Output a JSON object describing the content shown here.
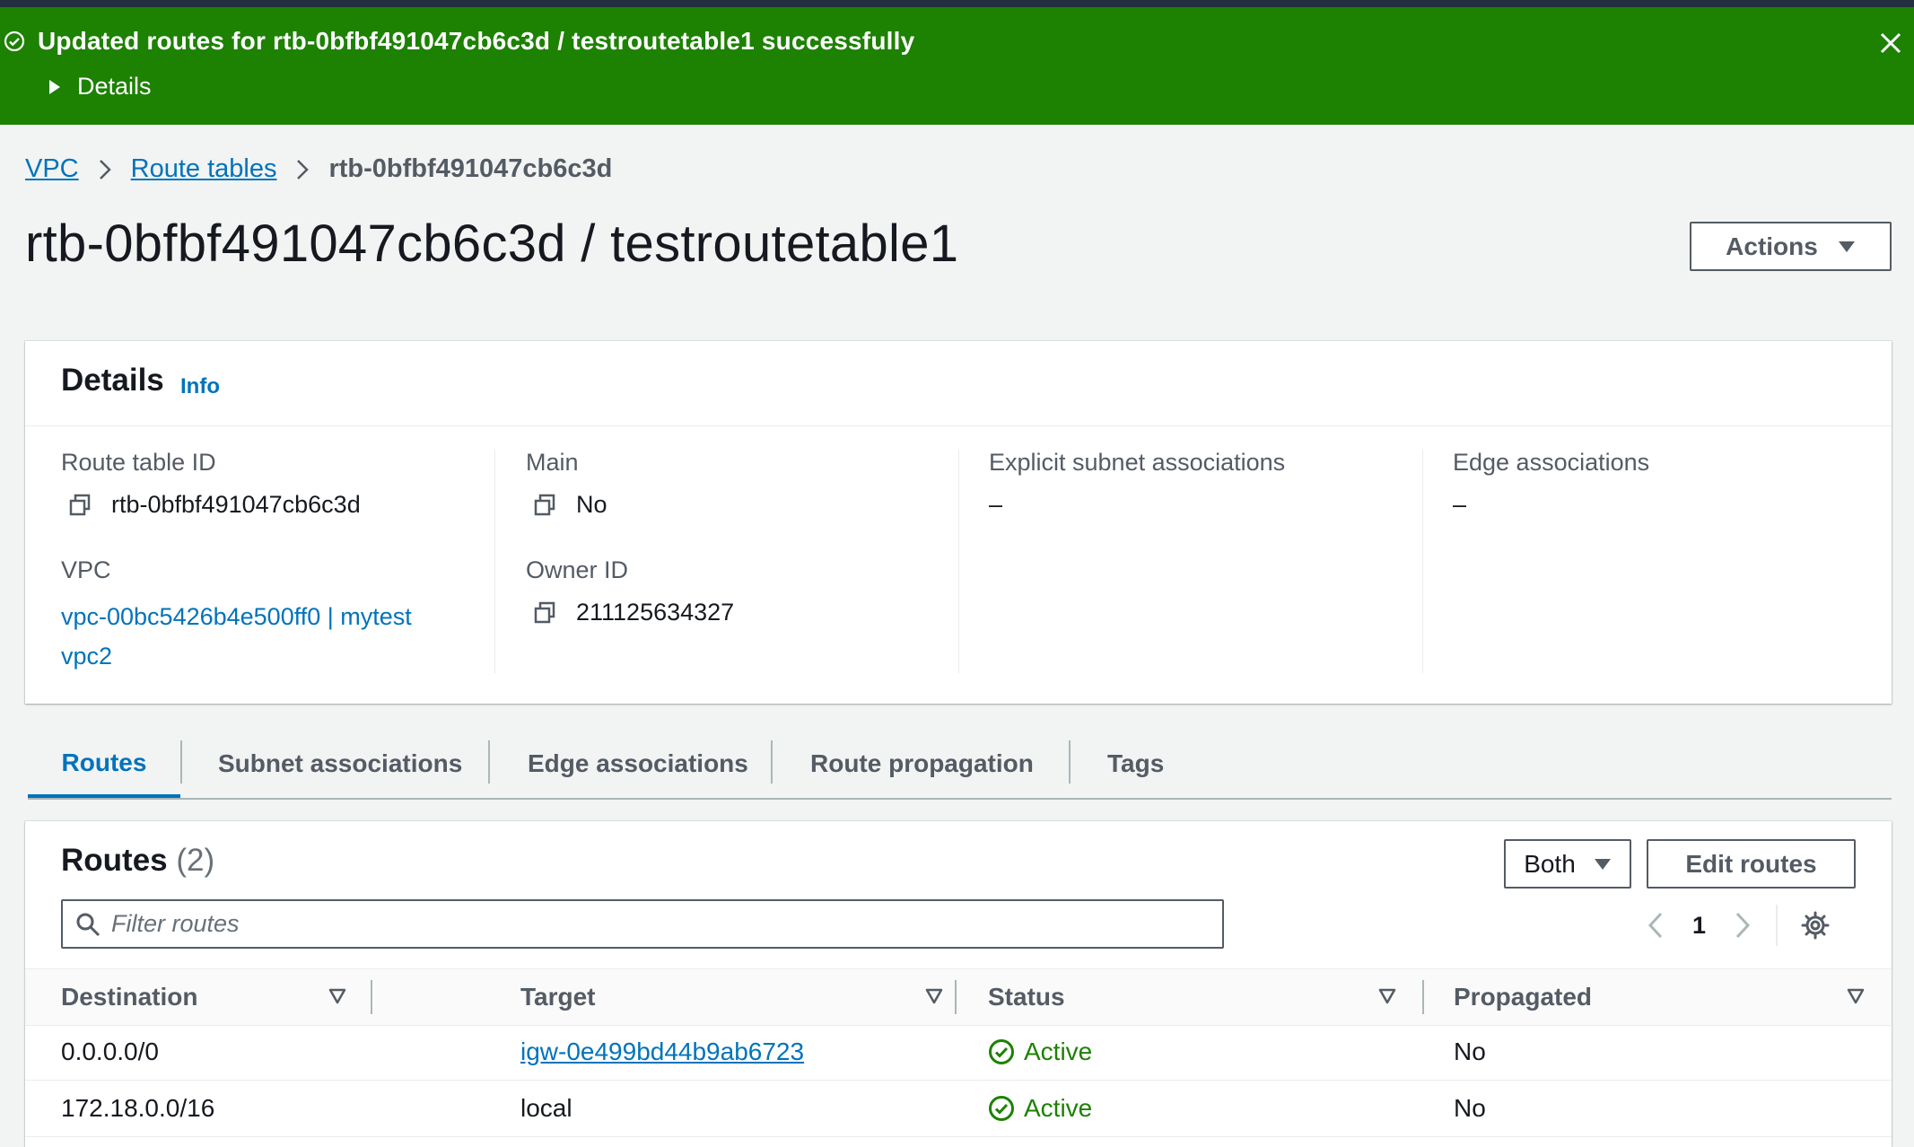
{
  "flash": {
    "message": "Updated routes for rtb-0bfbf491047cb6c3d / testroutetable1 successfully",
    "details_label": "Details",
    "type": "success",
    "color": "#1d8102"
  },
  "breadcrumb": {
    "items": [
      "VPC",
      "Route tables"
    ],
    "current": "rtb-0bfbf491047cb6c3d"
  },
  "page": {
    "title": "rtb-0bfbf491047cb6c3d / testroutetable1",
    "actions_label": "Actions"
  },
  "details": {
    "heading": "Details",
    "info_label": "Info",
    "route_table_id_label": "Route table ID",
    "route_table_id": "rtb-0bfbf491047cb6c3d",
    "main_label": "Main",
    "main": "No",
    "explicit_subnet_label": "Explicit subnet associations",
    "explicit_subnet": "–",
    "edge_assoc_label": "Edge associations",
    "edge_assoc": "–",
    "vpc_label": "VPC",
    "vpc_value": "vpc-00bc5426b4e500ff0 | mytest vpc2",
    "owner_label": "Owner ID",
    "owner": "211125634327"
  },
  "tabs": [
    {
      "label": "Routes",
      "active": true
    },
    {
      "label": "Subnet associations",
      "active": false
    },
    {
      "label": "Edge associations",
      "active": false
    },
    {
      "label": "Route propagation",
      "active": false
    },
    {
      "label": "Tags",
      "active": false
    }
  ],
  "routes": {
    "title": "Routes",
    "count": "(2)",
    "filter_select": "Both",
    "edit_label": "Edit routes",
    "filter_placeholder": "Filter routes",
    "page_number": "1",
    "columns": [
      "Destination",
      "Target",
      "Status",
      "Propagated"
    ],
    "rows": [
      {
        "destination": "0.0.0.0/0",
        "target": "igw-0e499bd44b9ab6723",
        "target_link": true,
        "status": "Active",
        "propagated": "No"
      },
      {
        "destination": "172.18.0.0/16",
        "target": "local",
        "target_link": false,
        "status": "Active",
        "propagated": "No"
      }
    ]
  },
  "colors": {
    "link": "#0073bb",
    "success": "#1d8102",
    "nav_dark": "#232f3e"
  }
}
